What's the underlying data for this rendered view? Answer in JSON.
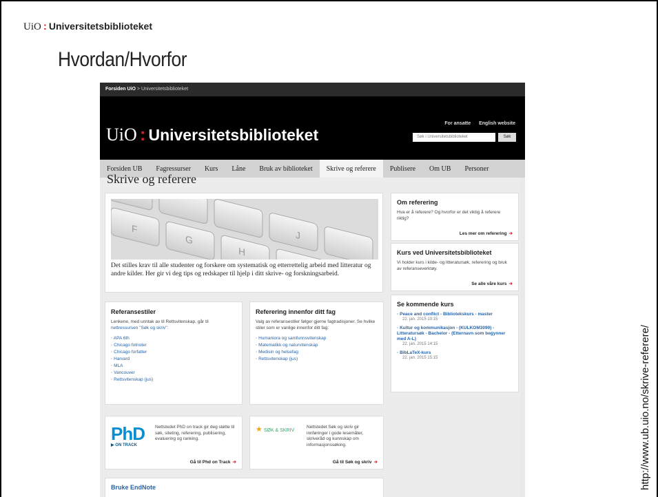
{
  "slide": {
    "logo_uio": "UiO",
    "logo_colon": ":",
    "logo_name": "Universitetsbiblioteket",
    "title": "Hvordan/Hvorfor",
    "side_url": "http://www.ub.uio.no/skrive-referere/"
  },
  "site": {
    "breadcrumb_home": "Forsiden UiO",
    "breadcrumb_sep": ">",
    "breadcrumb_current": "Universitetsbiblioteket",
    "banner_uio": "UiO",
    "banner_colon": ":",
    "banner_name": "Universitetsbiblioteket",
    "top_links": [
      "For ansatte",
      "English website"
    ],
    "search_placeholder": "Søk i Universitetsbiblioteket",
    "search_button": "Søk",
    "nav": [
      "Forsiden UB",
      "Fagressurser",
      "Kurs",
      "Låne",
      "Bruk av biblioteket",
      "Skrive og referere",
      "Publisere",
      "Om UB",
      "Personer"
    ],
    "active_nav": "Skrive og referere",
    "page_title": "Skrive og referere",
    "hero_text": "Det stilles krav til alle studenter og forskere om systematisk og etterrettelig arbeid med litteratur og andre kilder. Her gir vi deg tips og redskaper til hjelp i ditt skrive- og forskningsarbeid.",
    "keys": [
      "F",
      "G",
      "H",
      "J",
      "M"
    ]
  },
  "referansestiler": {
    "title": "Referansestiler",
    "intro": "Lenkene, med unntak av til Rettsvitenskap, går til",
    "intro_link": "nettressursen \"Søk og skriv\":",
    "items": [
      "APA 6th",
      "Chicago fotnoter",
      "Chicago forfatter",
      "Harvard",
      "MLA",
      "Vancouver",
      "Rettsvitenskap (jus)"
    ]
  },
  "referering_fag": {
    "title": "Referering innenfor ditt fag",
    "intro": "Valg av referansestiler følger gjerne fagtradisjoner. Se hvilke stiler som er vanlige innenfor ditt fag:",
    "items": [
      "Humaniora og samfunnsvitenskap",
      "Matematikk og naturvitenskap",
      "Medisin og helsefag",
      "Rettsvitenskap (jus)"
    ]
  },
  "phd": {
    "logo_big": "PhD",
    "logo_small": "▶ ON TRACK",
    "text": "Nettstedet PhD on track gir deg støtte til søk, siteting, referering, publisering, evaluering og ranking.",
    "link": "Gå til Phd on Track"
  },
  "sok": {
    "logo_star": "★",
    "logo_text": "SØK & SKRIV",
    "text": "Nettstedet Søk og skriv gir innføringer i gode lesemåter, skriveråd og kunnskap om informasjonssøking.",
    "link": "Gå til Søk og skriv"
  },
  "endnote": {
    "title": "Bruke EndNote"
  },
  "sidebar": {
    "om_title": "Om referering",
    "om_text": "Hva er å referere? Og hvorfor er det viktig å referere riktig?",
    "om_link": "Les mer om referering",
    "kurs_title": "Kurs ved Universitetsbiblioteket",
    "kurs_text": "Vi holder kurs i kilde- og litteratursøk, referering og bruk av referanseverktøy.",
    "kurs_link": "Se alle våre kurs",
    "kommende_title": "Se kommende kurs",
    "courses": [
      {
        "title": "◦ Peace and conflict - Bibliotekskurs - master",
        "date": "22. jan. 2015 10:15"
      },
      {
        "title": "◦ Kultur og kommunikasjon - (KULKOM3090) - Litteratursøk - Bachelor - (Etternavn som begynner med A-L)",
        "date": "22. jan. 2015 14:15"
      },
      {
        "title": "◦ BibLaTeX-kurs",
        "date": "22. jan. 2015 15:15"
      }
    ]
  },
  "arrow": "➔",
  "colors": {
    "accent_red": "#d41e2b",
    "link_blue": "#2a63a6",
    "banner_black": "#000000"
  }
}
